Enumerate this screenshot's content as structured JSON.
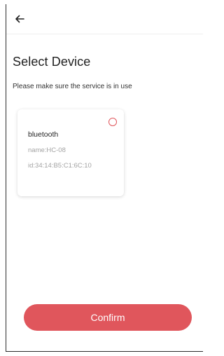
{
  "header": {
    "back_icon": "arrow-left-icon"
  },
  "page": {
    "title": "Select Device",
    "subtitle": "Please make sure the service is in use"
  },
  "devices": [
    {
      "type": "bluetooth",
      "name": "name:HC-08",
      "id": "id:34:14:B5:C1:6C:10",
      "selected": false
    }
  ],
  "actions": {
    "confirm_label": "Confirm"
  },
  "colors": {
    "accent": "#e0565c",
    "secondary_text": "#a3a3a3"
  }
}
